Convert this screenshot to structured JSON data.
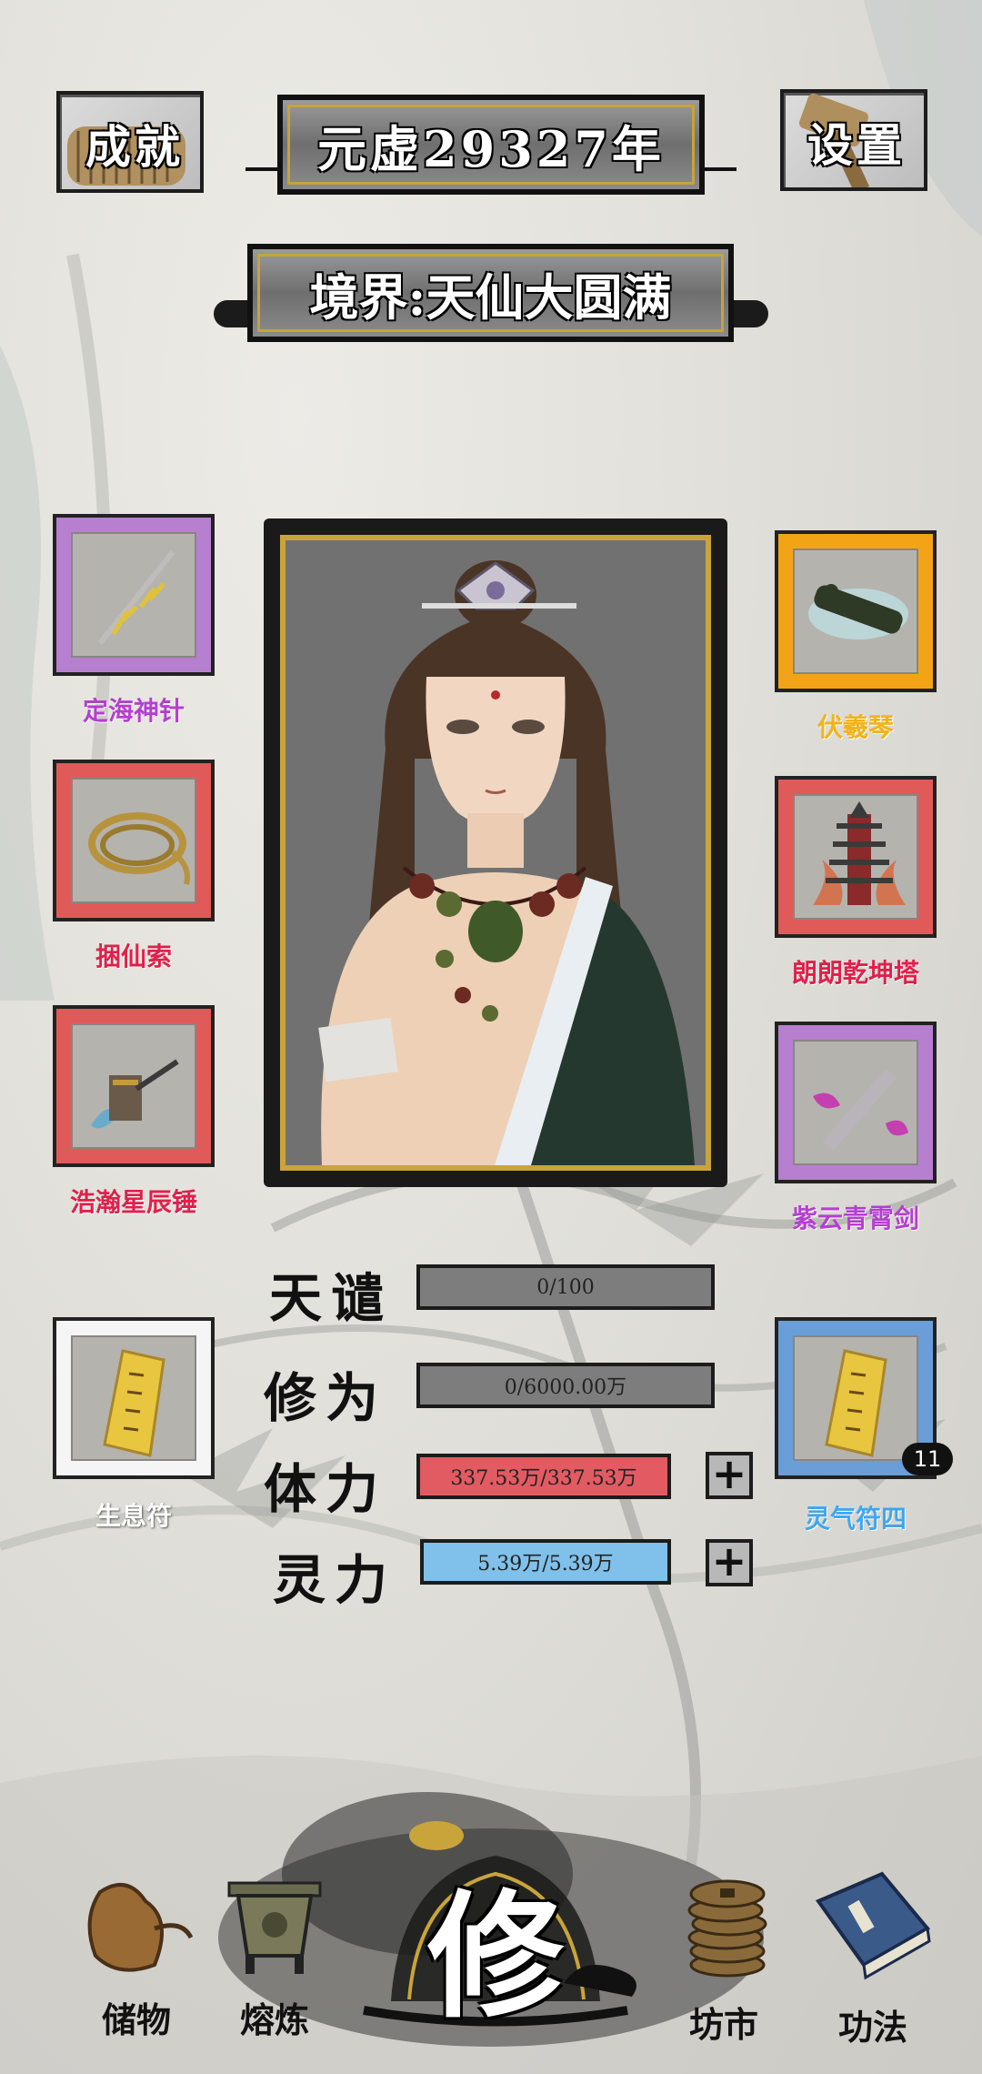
{
  "header": {
    "achievement_label": "成就",
    "year_label": "元虚29327年",
    "settings_label": "设置",
    "realm_label": "境界:天仙大圆满"
  },
  "equipment_left": [
    {
      "label": "定海神针",
      "color": "#b43fd0",
      "frame": "#b77fd0"
    },
    {
      "label": "捆仙索",
      "color": "#e0204a",
      "frame": "#e05a5a"
    },
    {
      "label": "浩瀚星辰锤",
      "color": "#e0204a",
      "frame": "#e05a5a"
    }
  ],
  "equipment_right": [
    {
      "label": "伏羲琴",
      "color": "#f3b21a",
      "frame": "#f3a416"
    },
    {
      "label": "朗朗乾坤塔",
      "color": "#e0204a",
      "frame": "#e05a5a"
    },
    {
      "label": "紫云青霄剑",
      "color": "#b43fd0",
      "frame": "#b77fd0"
    }
  ],
  "talisman_left": {
    "label": "生息符",
    "color": "#ffffff"
  },
  "talisman_right": {
    "label": "灵气符四",
    "color": "#3fa6f0",
    "badge": "11"
  },
  "stats": {
    "tianqian": {
      "label": "天谴",
      "value": "0/100",
      "color": "#7d7d7d"
    },
    "xiuwei": {
      "label": "修为",
      "value": "0/6000.00万",
      "color": "#7d7d7d"
    },
    "tili": {
      "label": "体力",
      "value": "337.53万/337.53万",
      "color": "#e25b63"
    },
    "lingli": {
      "label": "灵力",
      "value": "5.39万/5.39万",
      "color": "#7fc1ea"
    }
  },
  "nav": {
    "storage": "储物",
    "smelt": "熔炼",
    "cultivate": "修",
    "market": "坊市",
    "skills": "功法"
  },
  "icons": [
    "scroll-icon",
    "needle-icon",
    "rope-icon",
    "hammer-icon",
    "qin-icon",
    "pagoda-icon",
    "sword-icon",
    "talisman-icon",
    "bag-icon",
    "cauldron-icon",
    "coins-icon",
    "book-icon"
  ]
}
